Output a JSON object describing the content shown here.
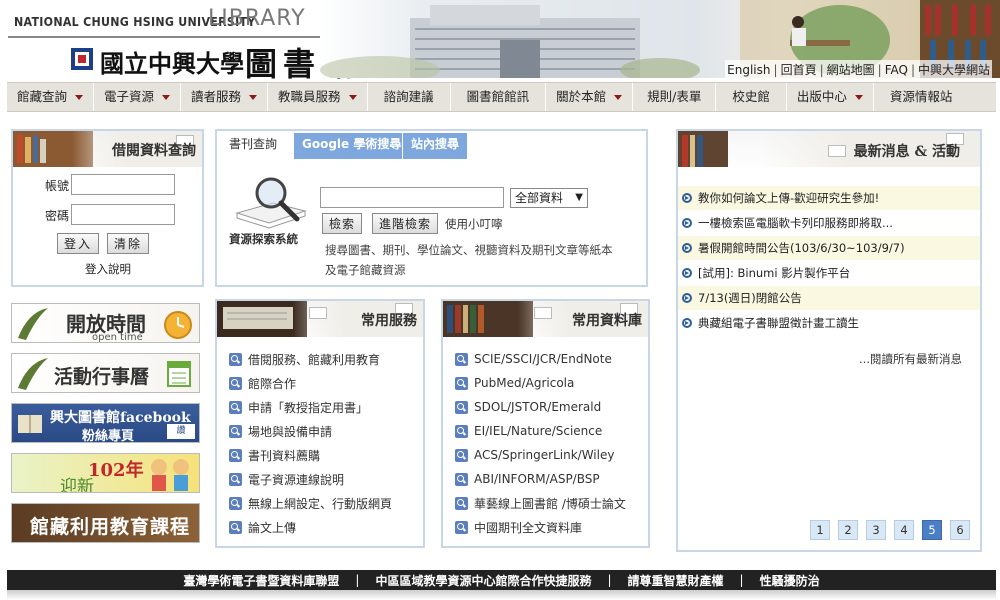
{
  "header": {
    "university_en": "NATIONAL CHUNG HSING UNIVERSITY",
    "library_en": "LIBRARY",
    "university_zh": "國立中興大學",
    "library_zh": "圖書館",
    "top_links": [
      "English",
      "回首頁",
      "網站地圖",
      "FAQ",
      "中興大學網站"
    ]
  },
  "nav": {
    "items": [
      {
        "label": "館藏查詢",
        "dropdown": true
      },
      {
        "label": "電子資源",
        "dropdown": true
      },
      {
        "label": "讀者服務",
        "dropdown": true
      },
      {
        "label": "教職員服務",
        "dropdown": true
      },
      {
        "label": "諮詢建議",
        "dropdown": false
      },
      {
        "label": "圖書館館訊",
        "dropdown": false
      },
      {
        "label": "關於本館",
        "dropdown": true
      },
      {
        "label": "規則/表單",
        "dropdown": false
      },
      {
        "label": "校史館",
        "dropdown": false
      },
      {
        "label": "出版中心",
        "dropdown": true
      },
      {
        "label": "資源情報站",
        "dropdown": false
      }
    ]
  },
  "login": {
    "title": "借閱資料查詢",
    "account_label": "帳號",
    "password_label": "密碼",
    "login_button": "登入",
    "clear_button": "清除",
    "help_link": "登入說明"
  },
  "search": {
    "tabs": [
      "書刊查詢",
      "Google 學術搜尋",
      "站內搜尋"
    ],
    "query_value": "",
    "scope_selected": "全部資料",
    "search_button": "檢索",
    "advanced_button": "進階檢索",
    "tips_link": "使用小叮嚀",
    "system_label": "資源探索系統",
    "description_line1": "搜尋圖書、期刊、學位論文、視聽資料及期刊文章等紙本",
    "description_line2": "及電子館藏資源"
  },
  "side_buttons": [
    {
      "label": "開放時間",
      "sub": "open time"
    },
    {
      "label": "活動行事曆"
    },
    {
      "label": "興大圖書館facebook",
      "sub": "粉絲專頁"
    },
    {
      "label": "102年",
      "sub": "迎新"
    },
    {
      "label": "館藏利用教育課程"
    }
  ],
  "services": {
    "title": "常用服務",
    "items": [
      "借閱服務、館藏利用教育",
      "館際合作",
      "申請「教授指定用書」",
      "場地與設備申請",
      "書刊資料薦購",
      "電子資源連線說明",
      "無線上網設定、行動版網頁",
      "論文上傳"
    ]
  },
  "databases": {
    "title": "常用資料庫",
    "items": [
      "SCIE/SSCI/JCR/EndNote",
      "PubMed/Agricola",
      "SDOL/JSTOR/Emerald",
      "EI/IEL/Nature/Science",
      "ACS/SpringerLink/Wiley",
      "ABI/INFORM/ASP/BSP",
      "華藝線上圖書館 /博碩士論文",
      "中國期刊全文資料庫"
    ]
  },
  "news": {
    "title": "最新消息 & 活動",
    "items": [
      "教你如何論文上傳-歡迎研究生參加!",
      "一樓檢索區電腦軟卡列印服務即將取...",
      "暑假開館時間公告(103/6/30~103/9/7)",
      "[試用]: Binumi 影片製作平台",
      "7/13(週日)閉館公告",
      "典藏組電子書聯盟徵計畫工讀生"
    ],
    "more_link": "...閱讀所有最新消息",
    "pages": [
      "1",
      "2",
      "3",
      "4",
      "5",
      "6"
    ],
    "current_page": "5"
  },
  "footer": {
    "links": [
      "臺灣學術電子書暨資料庫聯盟",
      "中區區域教學資源中心館際合作快捷服務",
      "請尊重智慧財產權",
      "性騷擾防治"
    ]
  },
  "colors": {
    "nav_bg": "#e6e3dc",
    "panel_border": "#c8d7e8",
    "tab_blue": "#7ea7dd",
    "news_odd": "#fbf8e2",
    "page_active": "#4a7fc5",
    "footer_bg": "#222222",
    "caret_red": "#8b1a1a"
  }
}
